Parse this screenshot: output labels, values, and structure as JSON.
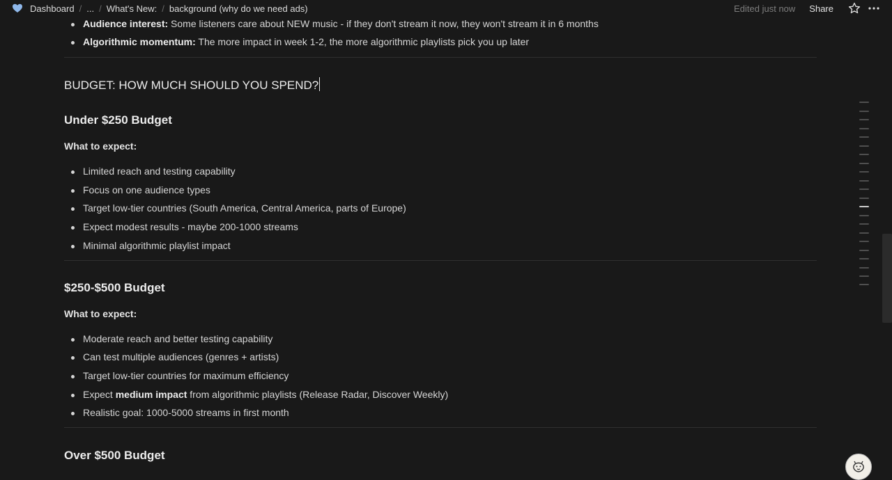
{
  "breadcrumbs": [
    "Dashboard",
    "...",
    "What's New:",
    "background (why do we need ads)"
  ],
  "header": {
    "edited": "Edited just now",
    "share": "Share"
  },
  "top_bullets": [
    {
      "bold": "Audience interest:",
      "text": " Some listeners care about NEW music - if they don't stream it now, they won't stream it in 6 months"
    },
    {
      "bold": "Algorithmic momentum:",
      "text": " The more impact in week 1-2, the more algorithmic playlists pick you up later"
    }
  ],
  "budget_heading": "BUDGET: HOW MUCH SHOULD YOU SPEND?",
  "what_to_expect": "What to expect:",
  "sections": [
    {
      "title": "Under $250 Budget",
      "items": [
        "Limited reach and testing capability",
        "Focus on one audience types",
        "Target low-tier countries (South America, Central America, parts of Europe)",
        "Expect modest results - maybe 200-1000 streams",
        "Minimal algorithmic playlist impact"
      ]
    },
    {
      "title": "$250-$500 Budget",
      "items": [
        "Moderate reach and better testing capability",
        "Can test multiple audiences (genres + artists)",
        "Target low-tier countries for maximum efficiency"
      ],
      "rich_item": {
        "pre": "Expect ",
        "bold": "medium impact",
        "post": " from algorithmic playlists (Release Radar, Discover Weekly)"
      },
      "last_item": "Realistic goal: 1000-5000 streams in first month"
    },
    {
      "title": "Over $500 Budget"
    }
  ],
  "icons": [
    "heart-icon",
    "star-icon",
    "more-icon",
    "avatar-icon"
  ],
  "colors": {
    "background": "#191919",
    "text": "#d4d4d4",
    "heart": "#8fb8ea"
  }
}
